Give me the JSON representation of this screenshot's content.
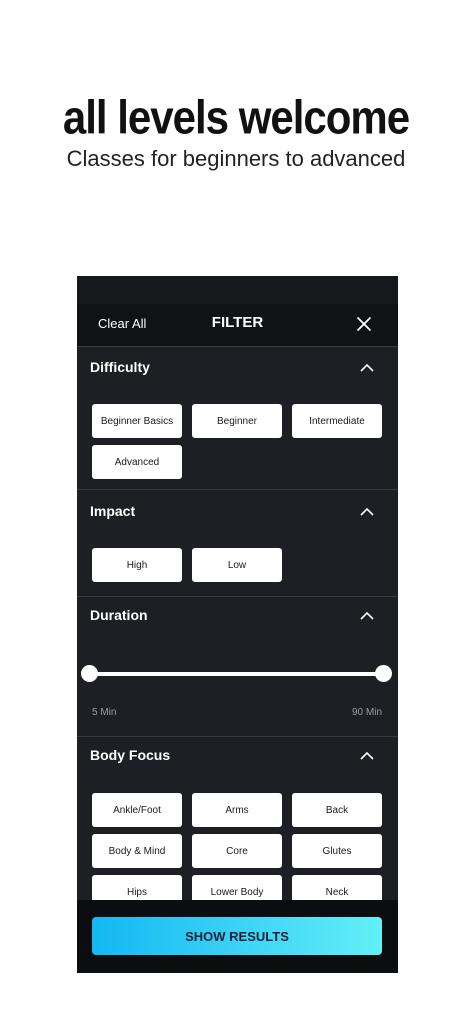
{
  "hero": {
    "title": "all levels welcome",
    "subtitle": "Classes for beginners to advanced"
  },
  "filter": {
    "clear_all": "Clear All",
    "title": "FILTER",
    "close_icon": "close-icon",
    "show_results": "SHOW RESULTS"
  },
  "difficulty": {
    "title": "Difficulty",
    "options": [
      "Beginner Basics",
      "Beginner",
      "Intermediate",
      "Advanced"
    ]
  },
  "impact": {
    "title": "Impact",
    "options": [
      "High",
      "Low"
    ]
  },
  "duration": {
    "title": "Duration",
    "min_label": "5 Min",
    "max_label": "90 Min"
  },
  "body_focus": {
    "title": "Body Focus",
    "options": [
      "Ankle/Foot",
      "Arms",
      "Back",
      "Body & Mind",
      "Core",
      "Glutes",
      "Hips",
      "Lower Body",
      "Neck"
    ]
  },
  "colors": {
    "panel_bg": "#1e1f24",
    "header_bg": "#111216",
    "button_gradient_start": "#12b8f2",
    "button_gradient_end": "#63f0f6"
  }
}
